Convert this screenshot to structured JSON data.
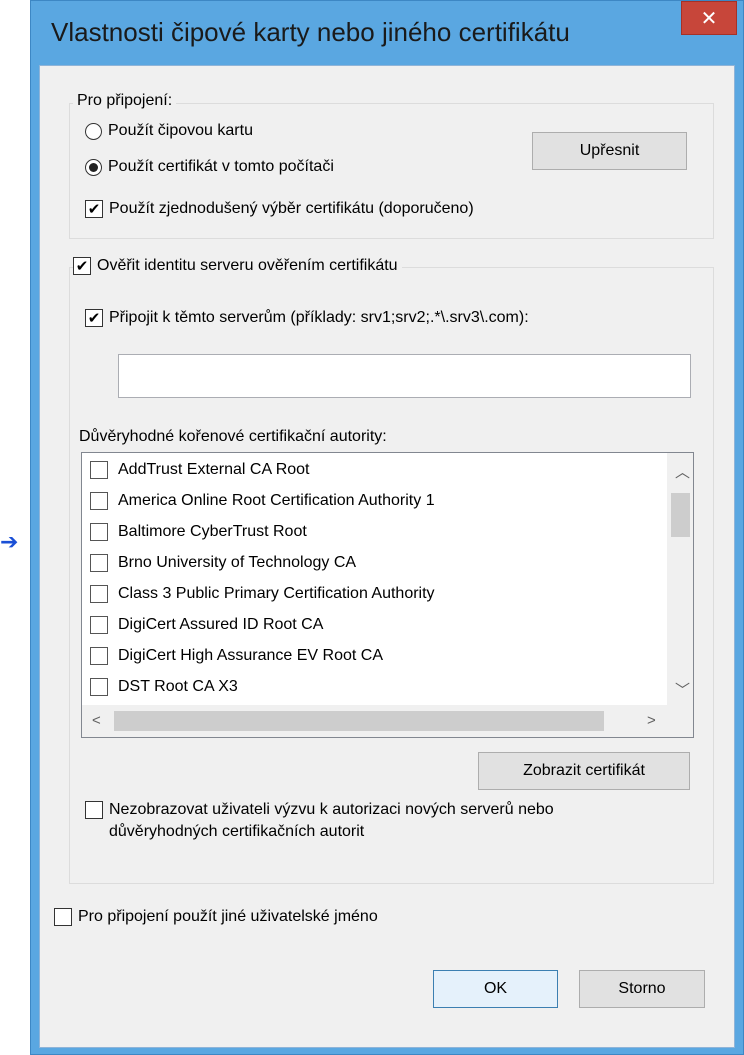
{
  "window": {
    "title": "Vlastnosti čipové karty nebo jiného certifikátu",
    "close_glyph": "✕"
  },
  "connect_group": {
    "legend": "Pro připojení:",
    "use_smart_card": "Použít čipovou kartu",
    "use_certificate": "Použít certifikát v tomto počítači",
    "simple_selection": "Použít zjednodušený výběr certifikátu (doporučeno)",
    "advanced_button": "Upřesnit",
    "selected_option": "use_certificate"
  },
  "verify_group": {
    "legend": "Ověřit identitu serveru ověřením certifikátu",
    "connect_servers": "Připojit k těmto serverům (příklady: srv1;srv2;.*\\.srv3\\.com):",
    "servers_value": "",
    "trusted_roots_label": "Důvěryhodné kořenové certifikační autority:",
    "trusted_roots": [
      "AddTrust External CA Root",
      "America Online Root Certification Authority 1",
      "Baltimore CyberTrust Root",
      "Brno University of Technology CA",
      "Class 3 Public Primary Certification Authority",
      "DigiCert Assured ID Root CA",
      "DigiCert High Assurance EV Root CA",
      "DST Root CA X3"
    ],
    "view_certificate_button": "Zobrazit certifikát",
    "no_prompt_line1": "Nezobrazovat uživateli výzvu k autorizaci nových serverů nebo",
    "no_prompt_line2": "důvěryhodných certifikačních autorit"
  },
  "other_user": "Pro připojení použít jiné uživatelské jméno",
  "buttons": {
    "ok": "OK",
    "cancel": "Storno"
  },
  "checkmark_glyph": "✔",
  "colors": {
    "titlebar": "#5aa7e1",
    "close": "#c7463a",
    "dialog_bg": "#f0f0f0"
  }
}
